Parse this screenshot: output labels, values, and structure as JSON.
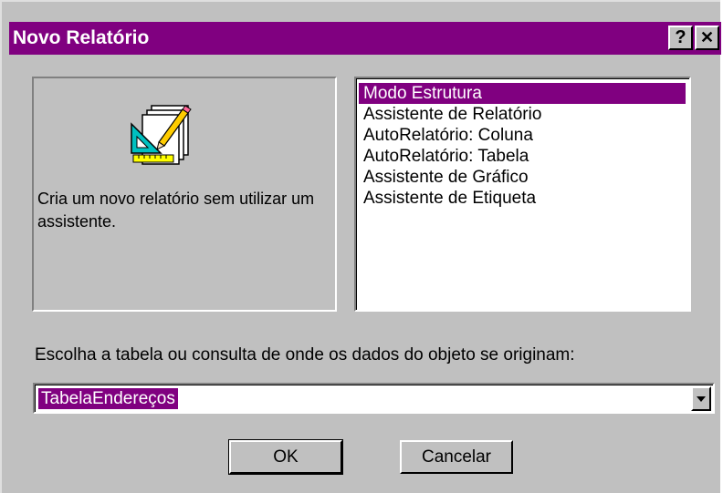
{
  "window": {
    "title": "Novo Relatório",
    "help_label": "?",
    "close_label": "✕"
  },
  "preview": {
    "description": "Cria um novo relatório sem utilizar um assistente.",
    "icon": "report-design-icon"
  },
  "list": {
    "items": [
      {
        "label": "Modo Estrutura",
        "selected": true
      },
      {
        "label": "Assistente de Relatório",
        "selected": false
      },
      {
        "label": "AutoRelatório:  Coluna",
        "selected": false
      },
      {
        "label": "AutoRelatório:  Tabela",
        "selected": false
      },
      {
        "label": "Assistente de Gráfico",
        "selected": false
      },
      {
        "label": "Assistente de Etiqueta",
        "selected": false
      }
    ]
  },
  "source": {
    "prompt": "Escolha a tabela ou consulta de onde os dados do objeto se originam:",
    "value": "TabelaEndereços"
  },
  "buttons": {
    "ok": "OK",
    "cancel": "Cancelar"
  },
  "colors": {
    "title_bar": "#800080",
    "selection": "#800080",
    "face": "#c0c0c0"
  }
}
